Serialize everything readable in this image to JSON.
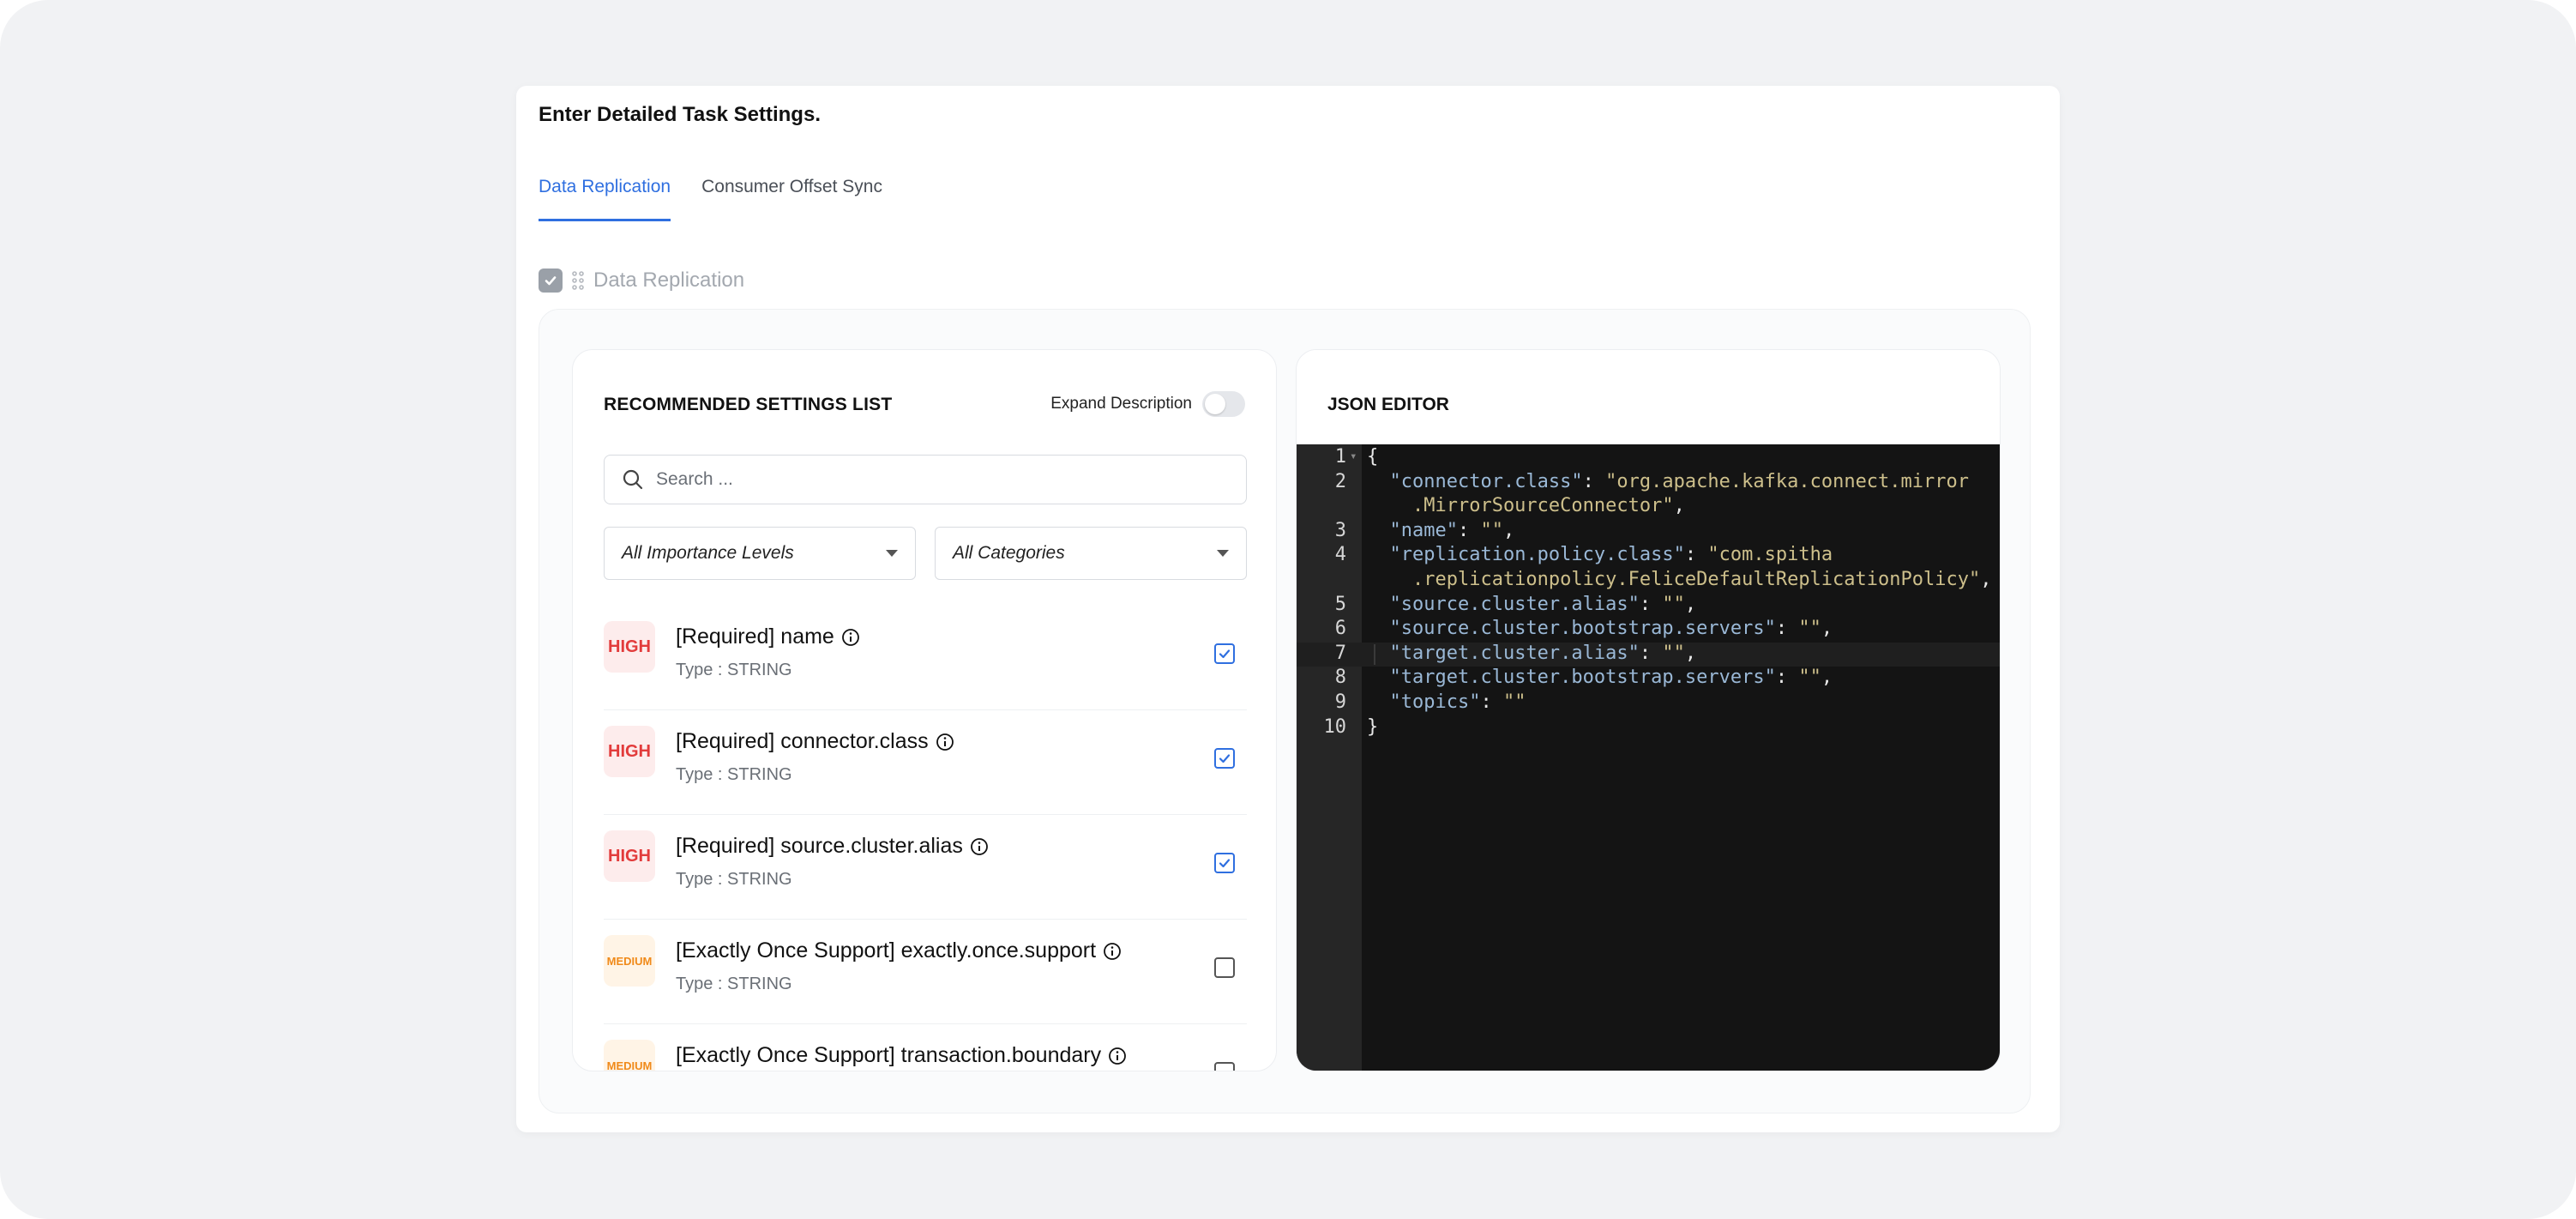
{
  "card": {
    "title": "Enter Detailed Task Settings."
  },
  "tabs": [
    {
      "label": "Data Replication",
      "active": true
    },
    {
      "label": "Consumer Offset Sync",
      "active": false
    }
  ],
  "section": {
    "label": "Data Replication",
    "checked": true
  },
  "recommended": {
    "title": "RECOMMENDED SETTINGS LIST",
    "expand_label": "Expand Description",
    "expand_on": false,
    "search_placeholder": "Search ...",
    "importance_filter": "All Importance Levels",
    "category_filter": "All Categories",
    "items": [
      {
        "badge": "HIGH",
        "title": "[Required] name",
        "type": "Type : STRING",
        "checked": true
      },
      {
        "badge": "HIGH",
        "title": "[Required] connector.class",
        "type": "Type : STRING",
        "checked": true
      },
      {
        "badge": "HIGH",
        "title": "[Required] source.cluster.alias",
        "type": "Type : STRING",
        "checked": true
      },
      {
        "badge": "MEDIUM",
        "title": "[Exactly Once Support] exactly.once.support",
        "type": "Type : STRING",
        "checked": false
      },
      {
        "badge": "MEDIUM",
        "title": "[Exactly Once Support] transaction.boundary",
        "type": "",
        "checked": false
      }
    ]
  },
  "json_editor": {
    "title": "JSON EDITOR",
    "lines": [
      {
        "n": "1",
        "parts": [
          [
            "p",
            "{"
          ]
        ]
      },
      {
        "n": "2",
        "parts": [
          [
            "p",
            "  "
          ],
          [
            "k",
            "\"connector.class\""
          ],
          [
            "p",
            ": "
          ],
          [
            "s",
            "\"org.apache.kafka.connect.mirror"
          ]
        ]
      },
      {
        "n": "",
        "parts": [
          [
            "s",
            "    .MirrorSourceConnector\""
          ],
          [
            "p",
            ","
          ]
        ]
      },
      {
        "n": "3",
        "parts": [
          [
            "p",
            "  "
          ],
          [
            "k",
            "\"name\""
          ],
          [
            "p",
            ": "
          ],
          [
            "s",
            "\"\""
          ],
          [
            "p",
            ","
          ]
        ]
      },
      {
        "n": "4",
        "parts": [
          [
            "p",
            "  "
          ],
          [
            "k",
            "\"replication.policy.class\""
          ],
          [
            "p",
            ": "
          ],
          [
            "s",
            "\"com.spitha"
          ]
        ]
      },
      {
        "n": "",
        "parts": [
          [
            "s",
            "    .replicationpolicy.FeliceDefaultReplicationPolicy\""
          ],
          [
            "p",
            ","
          ]
        ]
      },
      {
        "n": "5",
        "parts": [
          [
            "p",
            "  "
          ],
          [
            "k",
            "\"source.cluster.alias\""
          ],
          [
            "p",
            ": "
          ],
          [
            "s",
            "\"\""
          ],
          [
            "p",
            ","
          ]
        ]
      },
      {
        "n": "6",
        "parts": [
          [
            "p",
            "  "
          ],
          [
            "k",
            "\"source.cluster.bootstrap.servers\""
          ],
          [
            "p",
            ": "
          ],
          [
            "s",
            "\"\""
          ],
          [
            "p",
            ","
          ]
        ]
      },
      {
        "n": "7",
        "parts": [
          [
            "p",
            "  "
          ],
          [
            "k",
            "\"target.cluster.alias\""
          ],
          [
            "p",
            ": "
          ],
          [
            "s",
            "\"\""
          ],
          [
            "p",
            ","
          ]
        ]
      },
      {
        "n": "8",
        "parts": [
          [
            "p",
            "  "
          ],
          [
            "k",
            "\"target.cluster.bootstrap.servers\""
          ],
          [
            "p",
            ": "
          ],
          [
            "s",
            "\"\""
          ],
          [
            "p",
            ","
          ]
        ]
      },
      {
        "n": "9",
        "parts": [
          [
            "p",
            "  "
          ],
          [
            "k",
            "\"topics\""
          ],
          [
            "p",
            ": "
          ],
          [
            "s",
            "\"\""
          ]
        ]
      },
      {
        "n": "10",
        "parts": [
          [
            "p",
            "}"
          ]
        ]
      }
    ]
  },
  "colors": {
    "accent": "#2f6fe0",
    "high": "#e23b3b",
    "medium": "#f08a1a",
    "editor_bg": "#141414"
  }
}
